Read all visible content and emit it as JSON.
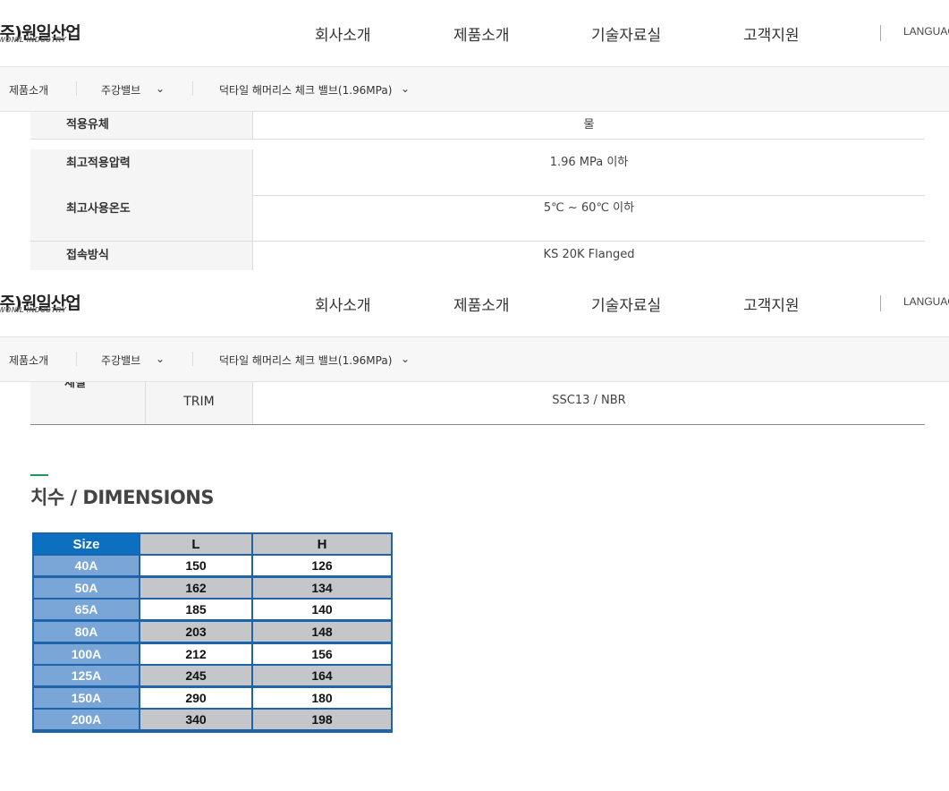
{
  "header": {
    "logo_main": "(주)원일산업",
    "logo_sub": "WONIL INDUSTRY",
    "nav": [
      "회사소개",
      "제품소개",
      "기술자료실",
      "고객지원"
    ],
    "language": "LANGUAGE"
  },
  "breadcrumb": {
    "home": "제품소개",
    "level1": "주강밸브",
    "level2": "덕타일 해머리스 체크 밸브(1.96MPa)"
  },
  "spec_table": {
    "rows": [
      {
        "key": "적용유체",
        "value": "물"
      },
      {
        "key": "최고적용압력",
        "value": "1.96 MPa 이하"
      },
      {
        "key": "최고사용온도",
        "value": "5℃ ~ 60℃ 이하"
      },
      {
        "key": "접속방식",
        "value": "KS 20K Flanged"
      }
    ]
  },
  "material_table": {
    "group_label_partial": "재질",
    "sub_key": "TRIM",
    "value": "SSC13 / NBR"
  },
  "dimensions": {
    "title": "치수 / DIMENSIONS",
    "headers": [
      "Size",
      "L",
      "H"
    ],
    "rows": [
      [
        "40A",
        "150",
        "126"
      ],
      [
        "50A",
        "162",
        "134"
      ],
      [
        "65A",
        "185",
        "140"
      ],
      [
        "80A",
        "203",
        "148"
      ],
      [
        "100A",
        "212",
        "156"
      ],
      [
        "125A",
        "245",
        "164"
      ],
      [
        "150A",
        "290",
        "180"
      ],
      [
        "200A",
        "340",
        "198"
      ]
    ]
  },
  "colors": {
    "accent_green": "#1a9b5a",
    "table_header_blue": "#0c6fc0",
    "size_column_blue": "#7aa6d7",
    "table_border": "#1d64ab"
  }
}
